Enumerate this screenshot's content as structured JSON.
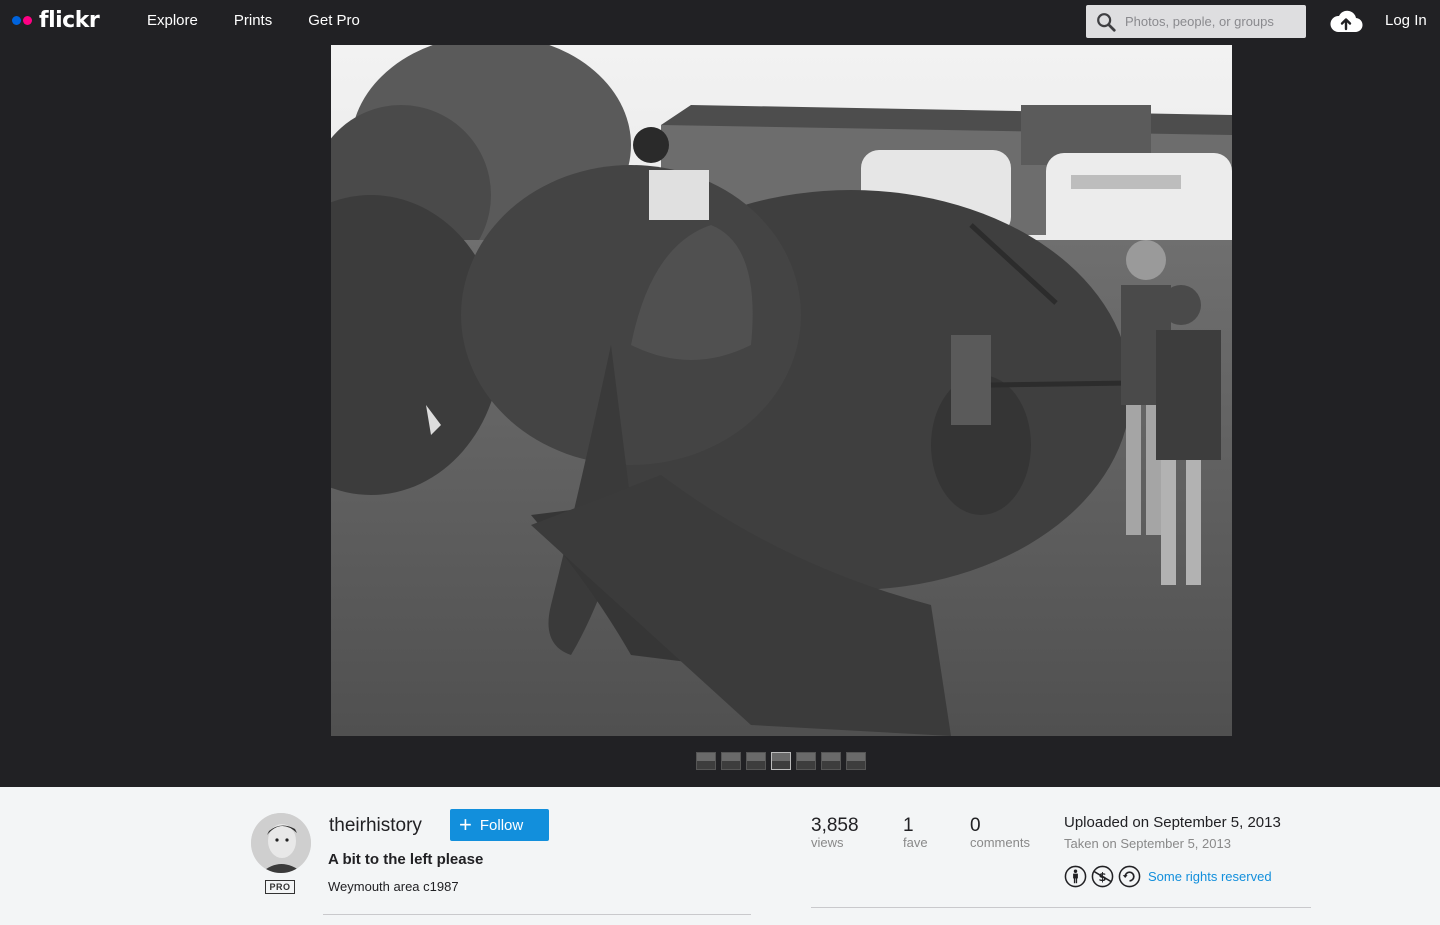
{
  "header": {
    "logo_text": "flickr",
    "nav": [
      "Explore",
      "Prints",
      "Get Pro"
    ],
    "search_placeholder": "Photos, people, or groups",
    "login_label": "Log In"
  },
  "photo": {
    "title": "A bit to the left please",
    "description": "Weymouth area c1987"
  },
  "filmstrip": {
    "count": 7,
    "active_index": 3
  },
  "owner": {
    "username": "theirhistory",
    "badge": "PRO",
    "follow_label": "Follow"
  },
  "stats": {
    "views": "3,858",
    "views_label": "views",
    "faves": "1",
    "faves_label": "fave",
    "comments": "0",
    "comments_label": "comments"
  },
  "dates": {
    "uploaded": "Uploaded on September 5, 2013",
    "taken": "Taken on September 5, 2013"
  },
  "license": {
    "icons": [
      "cc-by-icon",
      "cc-noncommercial-icon",
      "cc-sharealike-icon"
    ],
    "label": "Some rights reserved"
  },
  "colors": {
    "header_bg": "#212124",
    "accent": "#128fdc",
    "logo_blue": "#0063dc",
    "logo_pink": "#ff0084"
  }
}
